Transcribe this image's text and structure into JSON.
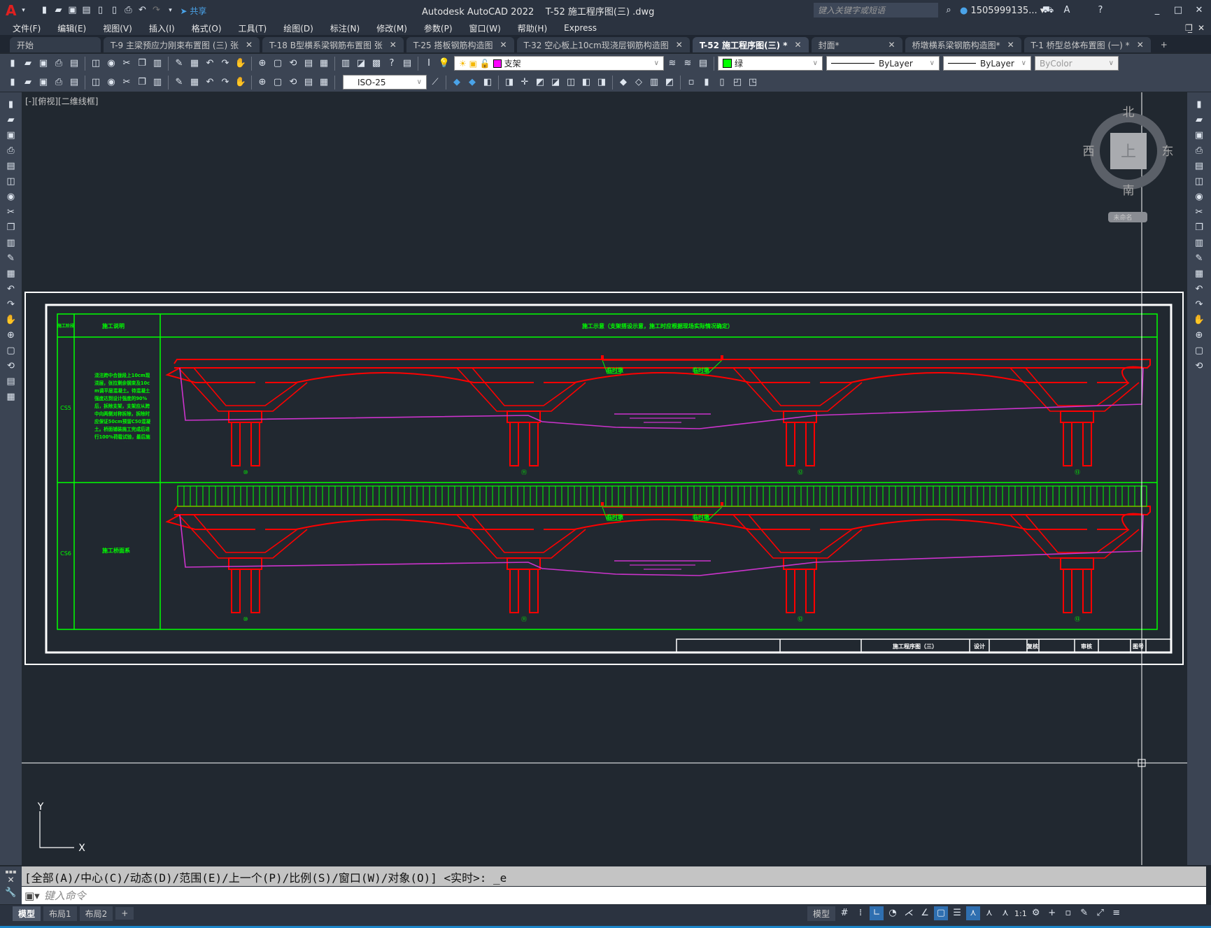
{
  "app": {
    "title": "Autodesk AutoCAD 2022    T-52 施工程序图(三) .dwg",
    "share_label": "共享",
    "search_placeholder": "键入关键字或短语",
    "user": "1505999135...",
    "accent": "#1c85c9"
  },
  "menu": [
    "文件(F)",
    "编辑(E)",
    "视图(V)",
    "插入(I)",
    "格式(O)",
    "工具(T)",
    "绘图(D)",
    "标注(N)",
    "修改(M)",
    "参数(P)",
    "窗口(W)",
    "帮助(H)",
    "Express"
  ],
  "tabs": [
    {
      "label": "开始",
      "closable": false,
      "active": false
    },
    {
      "label": "T-9 主梁预应力刚束布置图 (三) 张",
      "closable": true,
      "active": false
    },
    {
      "label": "T-18 B型横系梁钢筋布置图 张",
      "closable": true,
      "active": false
    },
    {
      "label": "T-25 搭板钢筋构造图",
      "closable": true,
      "active": false
    },
    {
      "label": "T-32 空心板上10cm现浇层钢筋构造图",
      "closable": true,
      "active": false
    },
    {
      "label": "T-52 施工程序图(三) *",
      "closable": true,
      "active": true
    },
    {
      "label": "封面*",
      "closable": true,
      "active": false
    },
    {
      "label": "桥墩横系梁钢筋构造图*",
      "closable": true,
      "active": false
    },
    {
      "label": "T-1 桥型总体布置图 (一) *",
      "closable": true,
      "active": false
    }
  ],
  "properties": {
    "layer": "支架",
    "layer_color": "#ff00ff",
    "color": "绿",
    "color_swatch": "#00ff00",
    "linetype": "ByLayer",
    "lineweight": "ByLayer",
    "plotstyle": "ByColor",
    "dimstyle": "ISO-25"
  },
  "viewport_label": "[-][俯视][二维线框]",
  "viewcube": {
    "north": "北",
    "south": "南",
    "east": "东",
    "west": "西",
    "face": "上",
    "ucs": "未命名"
  },
  "drawing": {
    "header_stage": "施工阶段",
    "header_desc": "施工说明",
    "header_diagram": "施工示意（支架搭设示意，施工时应根据现场实际情况确定）",
    "rows": [
      {
        "stage": "CS5",
        "desc": "浇注跨中合拢段上10cm现浇层，张拉剩余钢束及10cm调平层混凝土。待混凝土强度达到设计强度的90%后，拆除支架，支架应从跨中向两侧对称拆除，拆除时应保证50cm预留C50混凝土。桥面铺装施工完成后进行100%荷载试验，最后施工桥面系附属结构。"
      },
      {
        "stage": "CS6",
        "desc": "施工桥面系"
      }
    ],
    "temp_pier_label": "临时墩",
    "pier_numbers": [
      "⑩",
      "⑪",
      "⑫",
      "⑬"
    ],
    "titleblock": {
      "title": "施工程序图（三）",
      "design": "设计",
      "check": "复核",
      "review": "审核",
      "drawing_no": "图号"
    },
    "colors": {
      "table": "#00ff00",
      "structure": "#ff0000",
      "ground": "#cc33cc",
      "frame": "#ffffff"
    }
  },
  "command": {
    "history": "[全部(A)/中心(C)/动态(D)/范围(E)/上一个(P)/比例(S)/窗口(W)/对象(O)] <实时>: _e",
    "placeholder": "键入命令"
  },
  "layouts": [
    "模型",
    "布局1",
    "布局2"
  ],
  "status": {
    "model": "模型",
    "scale": "1:1"
  },
  "toolbar1_icons": [
    "qnew",
    "open",
    "save",
    "plot",
    "preview",
    "publish",
    "3d-dwf",
    "cut",
    "copy",
    "paste",
    "match-prop",
    "block-editor",
    "undo",
    "redo",
    "pan",
    "zoom-realtime",
    "zoom-window",
    "zoom-previous",
    "properties",
    "design-center",
    "tool-palettes",
    "sheet-set",
    "markup",
    "calculator",
    "help",
    "layer-properties"
  ],
  "toolbar2_icons": [
    "linear-dim",
    "aligned-dim",
    "arc-length",
    "ordinate",
    "radius",
    "jogged",
    "diameter",
    "angular",
    "quick-dim",
    "baseline",
    "continue",
    "dim-space",
    "dim-break",
    "tolerance",
    "center-mark",
    "inspect",
    "jogged-linear",
    "dim-edit",
    "dim-text-edit",
    "dim-update"
  ],
  "left_tools": [
    "line",
    "construction-line",
    "polyline",
    "polygon",
    "rectangle",
    "arc",
    "circle",
    "revcloud",
    "spline",
    "ellipse",
    "ellipse-arc",
    "insert-block",
    "make-block",
    "point",
    "hatch",
    "gradient",
    "region",
    "table",
    "multiline-text",
    "add-selected"
  ],
  "right_tools": [
    "erase",
    "copy",
    "mirror",
    "offset",
    "array",
    "move",
    "rotate",
    "scale",
    "stretch",
    "trim",
    "extend",
    "break-at-point",
    "break",
    "join",
    "chamfer",
    "fillet",
    "blend",
    "explode"
  ]
}
